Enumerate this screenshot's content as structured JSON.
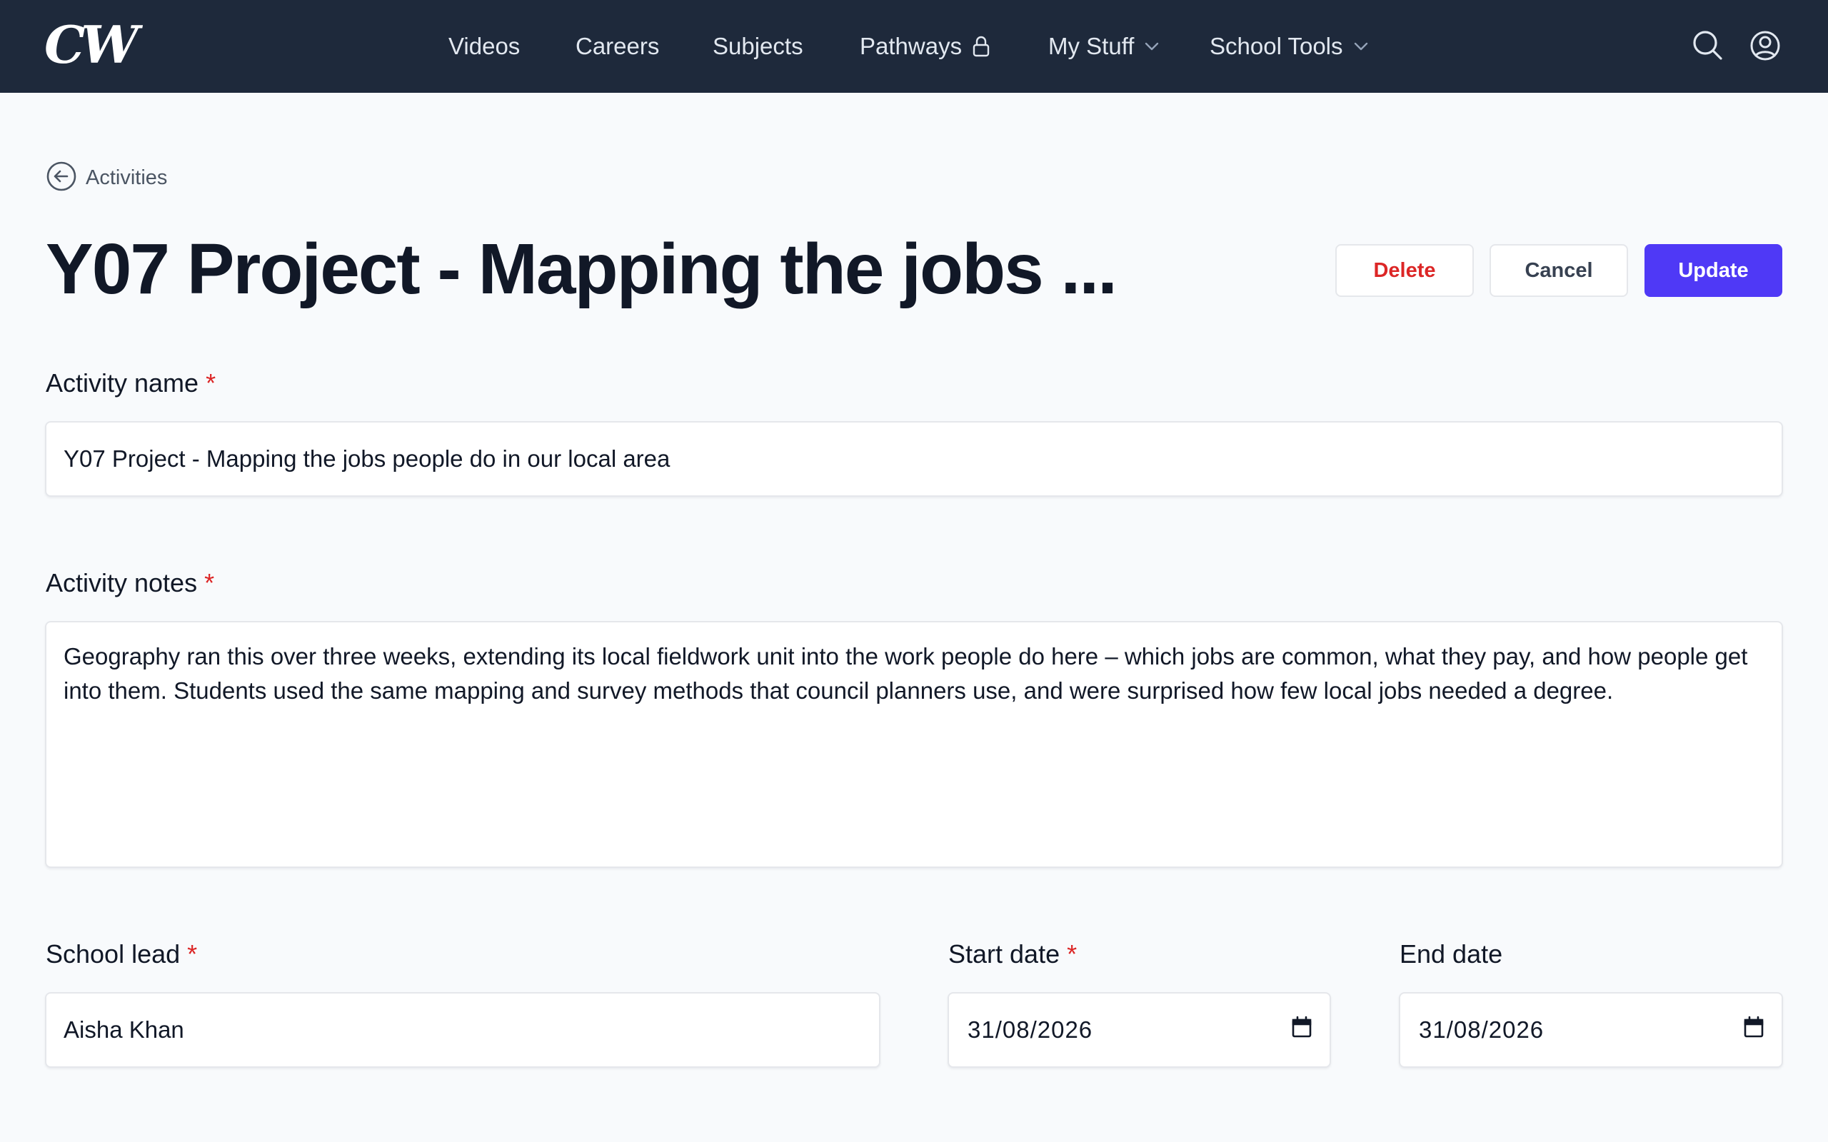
{
  "logo": {
    "text": "CW"
  },
  "nav": {
    "items": [
      {
        "label": "Videos"
      },
      {
        "label": "Careers"
      },
      {
        "label": "Subjects"
      },
      {
        "label": "Pathways",
        "icon": "lock-icon"
      },
      {
        "label": "My Stuff",
        "icon": "chevron-down-icon"
      },
      {
        "label": "School Tools",
        "icon": "chevron-down-icon"
      }
    ],
    "right_icons": [
      "search-icon",
      "account-icon"
    ]
  },
  "breadcrumb": {
    "back_label": "Activities",
    "icon": "arrow-left-circle-icon"
  },
  "page": {
    "title": "Y07 Project - Mapping the jobs ...",
    "buttons": {
      "delete": "Delete",
      "cancel": "Cancel",
      "update": "Update"
    }
  },
  "form": {
    "activity_name": {
      "label": "Activity name",
      "required_mark": "*",
      "value": "Y07 Project - Mapping the jobs people do in our local area"
    },
    "activity_notes": {
      "label": "Activity notes",
      "required_mark": "*",
      "value": "Geography ran this over three weeks, extending its local fieldwork unit into the work people do here – which jobs are common, what they pay, and how people get into them. Students used the same mapping and survey methods that council planners use, and were surprised how few local jobs needed a degree."
    },
    "school_lead": {
      "label": "School lead",
      "required_mark": "*",
      "value": "Aisha Khan"
    },
    "start_date": {
      "label": "Start date",
      "required_mark": "*",
      "value": "31/08/2026",
      "icon": "calendar-icon"
    },
    "end_date": {
      "label": "End date",
      "value": "31/08/2026",
      "icon": "calendar-icon"
    }
  },
  "colors": {
    "nav_bg": "#1e293b",
    "primary": "#4f39f6",
    "danger": "#dc2626",
    "page_bg": "#f8fafc"
  }
}
